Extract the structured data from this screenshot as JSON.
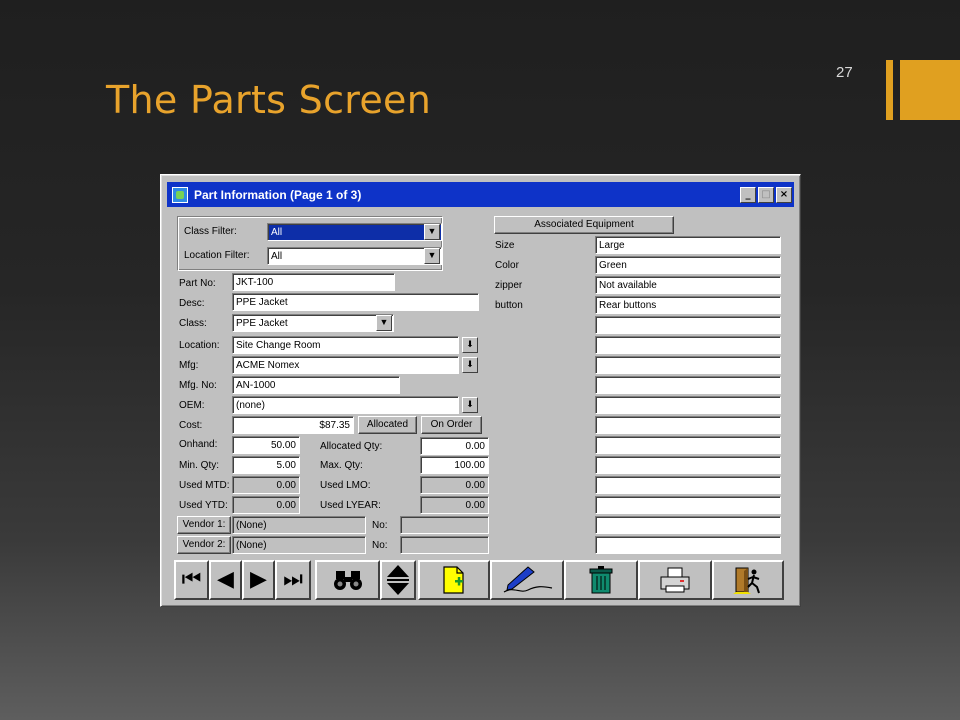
{
  "slide": {
    "title": "The Parts Screen",
    "number": "27"
  },
  "window": {
    "title": "Part Information (Page 1 of 3)",
    "controls": {
      "minimize": "_",
      "maximize": "□",
      "close": "×"
    }
  },
  "filters": {
    "class_label": "Class Filter:",
    "class_value": "All",
    "location_label": "Location Filter:",
    "location_value": "All"
  },
  "part": {
    "part_no_label": "Part No:",
    "part_no": "JKT-100",
    "desc_label": "Desc:",
    "desc": "PPE Jacket",
    "class_label": "Class:",
    "class": "PPE Jacket",
    "location_label": "Location:",
    "location": "Site Change Room",
    "mfg_label": "Mfg:",
    "mfg": "ACME Nomex",
    "mfg_no_label": "Mfg. No:",
    "mfg_no": "AN-1000",
    "oem_label": "OEM:",
    "oem": "(none)",
    "cost_label": "Cost:",
    "cost": "$87.35",
    "allocated_button": "Allocated",
    "on_order_button": "On Order"
  },
  "qty": {
    "onhand_label": "Onhand:",
    "onhand": "50.00",
    "min_label": "Min. Qty:",
    "min": "5.00",
    "used_mtd_label": "Used MTD:",
    "used_mtd": "0.00",
    "used_ytd_label": "Used YTD:",
    "used_ytd": "0.00",
    "allocated_label": "Allocated Qty:",
    "allocated": "0.00",
    "max_label": "Max. Qty:",
    "max": "100.00",
    "used_lmo_label": "Used LMO:",
    "used_lmo": "0.00",
    "used_lyear_label": "Used LYEAR:",
    "used_lyear": "0.00"
  },
  "vendors": [
    {
      "button": "Vendor 1:",
      "name": "(None)",
      "no_label": "No:",
      "no": ""
    },
    {
      "button": "Vendor 2:",
      "name": "(None)",
      "no_label": "No:",
      "no": ""
    }
  ],
  "attributes": {
    "button": "Associated Equipment",
    "rows": [
      {
        "name": "Size",
        "value": "Large"
      },
      {
        "name": "Color",
        "value": "Green"
      },
      {
        "name": "zipper",
        "value": "Not available"
      },
      {
        "name": "button",
        "value": "Rear buttons"
      },
      {
        "name": "",
        "value": ""
      },
      {
        "name": "",
        "value": ""
      },
      {
        "name": "",
        "value": ""
      },
      {
        "name": "",
        "value": ""
      },
      {
        "name": "",
        "value": ""
      },
      {
        "name": "",
        "value": ""
      },
      {
        "name": "",
        "value": ""
      },
      {
        "name": "",
        "value": ""
      },
      {
        "name": "",
        "value": ""
      },
      {
        "name": "",
        "value": ""
      },
      {
        "name": "",
        "value": ""
      },
      {
        "name": "",
        "value": ""
      }
    ]
  },
  "toolbar": {
    "icons": [
      "first-record-icon",
      "previous-record-icon",
      "next-record-icon",
      "last-record-icon",
      "find-binoculars-icon",
      "scroll-up-down-icon",
      "new-record-icon",
      "edit-pen-icon",
      "delete-trash-icon",
      "print-icon",
      "exit-door-icon"
    ]
  },
  "colors": {
    "title_accent": "#e8a32c",
    "window_title_bar": "#0e33c8",
    "window_face": "#c0c0c0"
  }
}
